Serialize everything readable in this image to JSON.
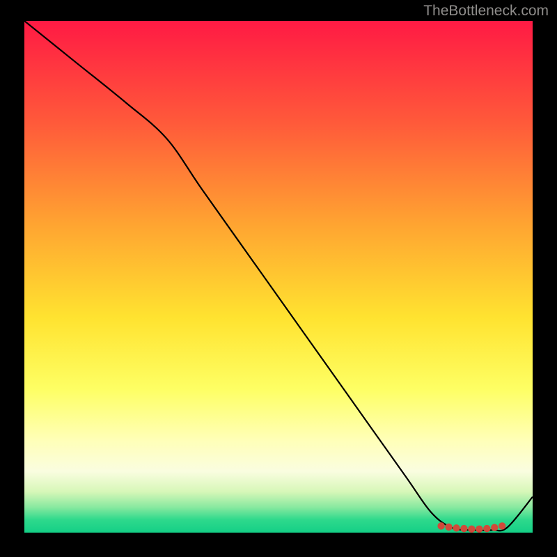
{
  "watermark": "TheBottleneck.com",
  "chart_data": {
    "type": "line",
    "title": "",
    "xlabel": "",
    "ylabel": "",
    "xlim": [
      0,
      100
    ],
    "ylim": [
      0,
      100
    ],
    "gradient_stops": [
      {
        "offset": 0,
        "color": "#ff1a44"
      },
      {
        "offset": 20,
        "color": "#ff5a3a"
      },
      {
        "offset": 40,
        "color": "#ffa531"
      },
      {
        "offset": 58,
        "color": "#ffe330"
      },
      {
        "offset": 72,
        "color": "#feff64"
      },
      {
        "offset": 82,
        "color": "#ffffb8"
      },
      {
        "offset": 88,
        "color": "#fafde0"
      },
      {
        "offset": 92,
        "color": "#d7f7b8"
      },
      {
        "offset": 95,
        "color": "#89e9a0"
      },
      {
        "offset": 97.5,
        "color": "#2ed98c"
      },
      {
        "offset": 100,
        "color": "#14cf86"
      }
    ],
    "series": [
      {
        "name": "bottleneck-curve",
        "x": [
          0,
          10,
          20,
          28,
          35,
          45,
          55,
          65,
          75,
          80,
          84,
          88,
          92,
          95,
          100
        ],
        "y": [
          100,
          92,
          84,
          77,
          67,
          53,
          39,
          25,
          11,
          4,
          1,
          0.5,
          0.5,
          1,
          7
        ]
      }
    ],
    "markers": {
      "name": "optimal-range",
      "color": "#d04a3a",
      "points": [
        {
          "x": 82,
          "y": 1.3
        },
        {
          "x": 83.5,
          "y": 1.1
        },
        {
          "x": 85,
          "y": 0.9
        },
        {
          "x": 86.5,
          "y": 0.8
        },
        {
          "x": 88,
          "y": 0.7
        },
        {
          "x": 89.5,
          "y": 0.7
        },
        {
          "x": 91,
          "y": 0.8
        },
        {
          "x": 92.5,
          "y": 1.0
        },
        {
          "x": 94,
          "y": 1.3
        }
      ]
    }
  }
}
